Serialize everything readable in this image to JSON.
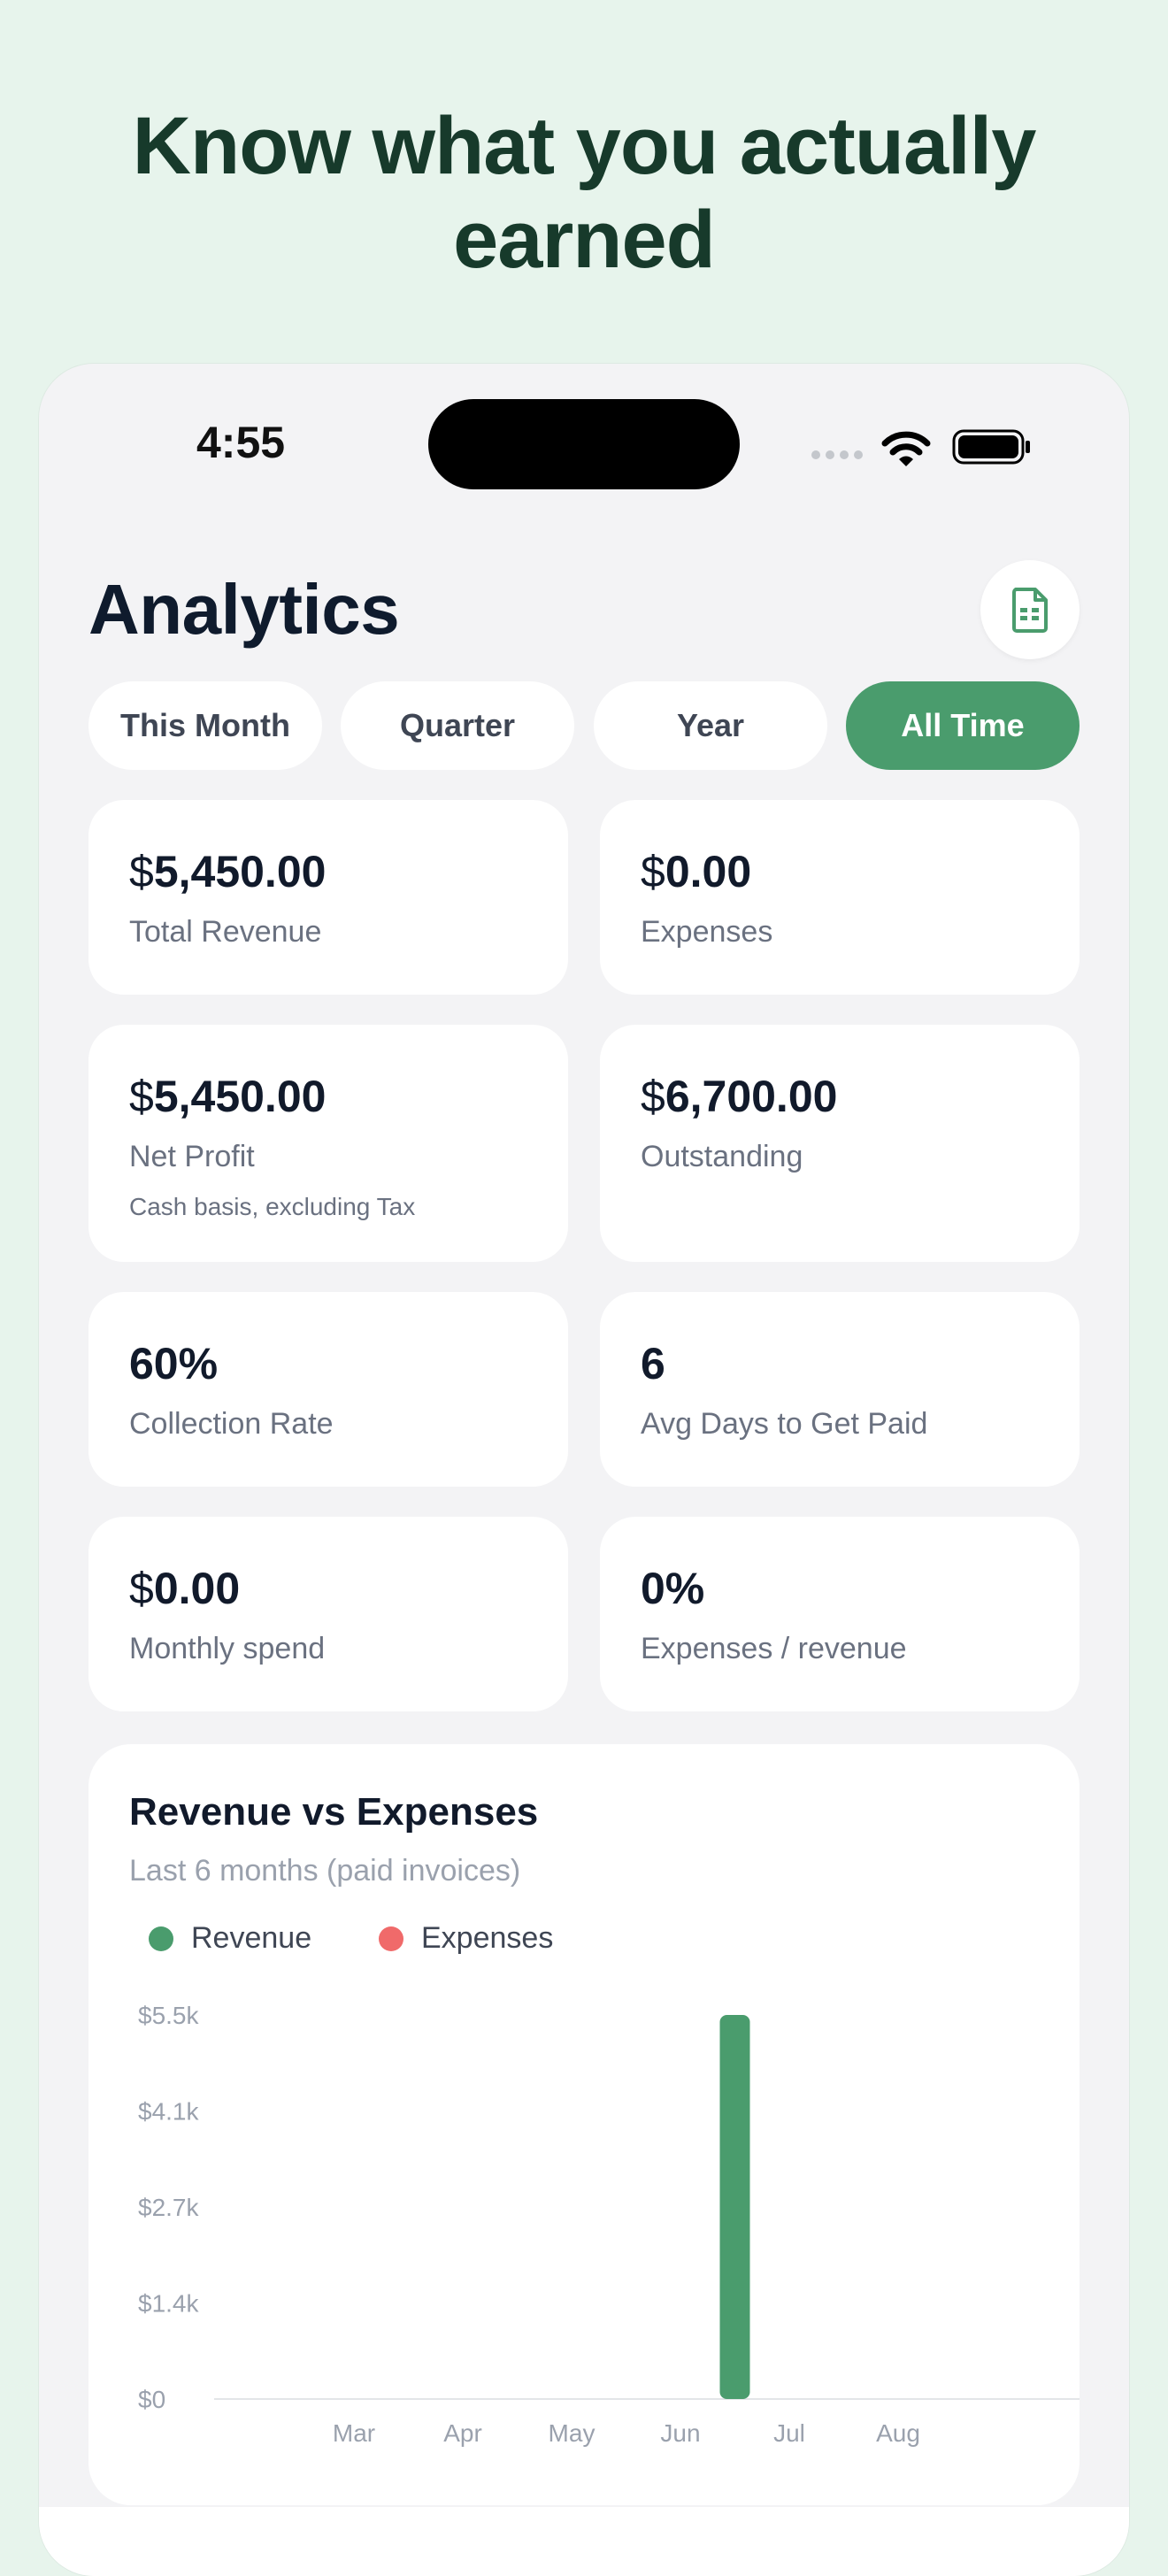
{
  "headline": "Know what you actually earned",
  "status": {
    "time": "4:55"
  },
  "page": {
    "title": "Analytics",
    "export_icon": "spreadsheet-icon"
  },
  "tabs": [
    {
      "label": "This Month",
      "active": false
    },
    {
      "label": "Quarter",
      "active": false
    },
    {
      "label": "Year",
      "active": false
    },
    {
      "label": "All Time",
      "active": true
    }
  ],
  "metrics": {
    "total_revenue": {
      "currency": "$",
      "value": "5,450.00",
      "label": "Total Revenue"
    },
    "expenses": {
      "currency": "$",
      "value": "0.00",
      "label": "Expenses"
    },
    "net_profit": {
      "currency": "$",
      "value": "5,450.00",
      "label": "Net Profit",
      "note": "Cash basis, excluding Tax"
    },
    "outstanding": {
      "currency": "$",
      "value": "6,700.00",
      "label": "Outstanding"
    },
    "collection_rate": {
      "value": "60%",
      "label": "Collection Rate"
    },
    "avg_days": {
      "value": "6",
      "label": "Avg Days to Get Paid"
    },
    "monthly_spend": {
      "currency": "$",
      "value": "0.00",
      "label": "Monthly spend"
    },
    "expense_ratio": {
      "value": "0%",
      "label": "Expenses / revenue"
    }
  },
  "chart": {
    "title": "Revenue vs Expenses",
    "subtitle": "Last 6 months (paid invoices)"
  },
  "colors": {
    "accent": "#4a9c6d",
    "revenue": "#4a9c6d",
    "expenses": "#f06a6a"
  },
  "chart_data": {
    "type": "bar",
    "title": "Revenue vs Expenses",
    "subtitle": "Last 6 months (paid invoices)",
    "categories": [
      "Mar",
      "Apr",
      "May",
      "Jun",
      "Jul",
      "Aug"
    ],
    "series": [
      {
        "name": "Revenue",
        "color": "#4a9c6d",
        "values": [
          0,
          0,
          0,
          5450,
          0,
          0
        ]
      },
      {
        "name": "Expenses",
        "color": "#f06a6a",
        "values": [
          0,
          0,
          0,
          0,
          0,
          0
        ]
      }
    ],
    "y_ticks": [
      "$5.5k",
      "$4.1k",
      "$2.7k",
      "$1.4k",
      "$0"
    ],
    "ylim": [
      0,
      5450
    ],
    "grid": false,
    "legend": "top-left"
  }
}
